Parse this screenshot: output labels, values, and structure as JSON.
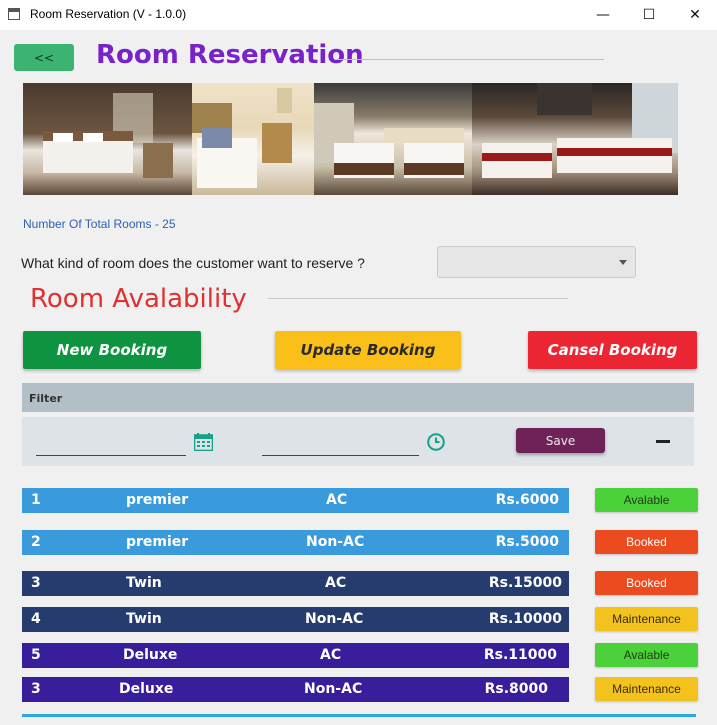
{
  "window": {
    "title": "Room Reservation (V - 1.0.0)",
    "minimize": "—",
    "maximize": "☐",
    "close": "✕"
  },
  "header": {
    "back_label": "<<",
    "title": "Room Reservation"
  },
  "photos": [
    {
      "name": "hotel-photo-1"
    },
    {
      "name": "hotel-photo-2"
    },
    {
      "name": "hotel-photo-3"
    },
    {
      "name": "hotel-photo-4"
    }
  ],
  "info": {
    "total_rooms": "Number Of Total Rooms - 25",
    "question": "What kind of room does the customer want to reserve ?",
    "room_type_selected": ""
  },
  "availability": {
    "title": "Room Avalability"
  },
  "actions": {
    "new_booking": "New Booking",
    "update_booking": "Update Booking",
    "cancel_booking": "Cansel  Booking"
  },
  "filter": {
    "label": "Filter",
    "date_value": "",
    "time_value": "",
    "save_label": "Save",
    "icons": {
      "date": "calendar-icon",
      "time": "clock-icon",
      "collapse": "minus-icon"
    }
  },
  "rooms": [
    {
      "no": "1",
      "type": "premier",
      "ac": "AC",
      "price": "Rs.6000",
      "status": "Avalable"
    },
    {
      "no": "2",
      "type": "premier",
      "ac": "Non-AC",
      "price": "Rs.5000",
      "status": "Booked"
    },
    {
      "no": "3",
      "type": "Twin",
      "ac": "AC",
      "price": "Rs.15000",
      "status": "Booked"
    },
    {
      "no": "4",
      "type": "Twin",
      "ac": "Non-AC",
      "price": "Rs.10000",
      "status": "Maintenance"
    },
    {
      "no": "5",
      "type": "Deluxe",
      "ac": "AC",
      "price": "Rs.11000",
      "status": "Avalable"
    },
    {
      "no": "3",
      "type": "Deluxe",
      "ac": "Non-AC",
      "price": "Rs.8000",
      "status": "Maintenance"
    }
  ],
  "colors": {
    "title_purple": "#7a22c9",
    "availability_red": "#e03030",
    "new_booking_green": "#0e9440",
    "update_booking_yellow": "#fbbf1a",
    "cancel_booking_red": "#eb2632",
    "premier_row": "#3a9bdc",
    "twin_row": "#263c6e",
    "deluxe_row": "#381e9a",
    "status_available": "#4bd13a",
    "status_booked": "#ec4a1f",
    "status_maintenance": "#f4c21d"
  }
}
